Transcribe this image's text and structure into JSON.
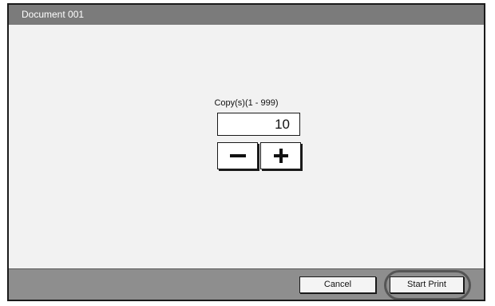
{
  "window": {
    "title": "Document 001"
  },
  "copies": {
    "label": "Copy(s)(1 - 999)",
    "value": "10"
  },
  "stepper": {
    "minus_icon": "minus-icon",
    "plus_icon": "plus-icon"
  },
  "actions": {
    "cancel_label": "Cancel",
    "start_print_label": "Start Print"
  },
  "colors": {
    "title_bar": "#7b7b7b",
    "content_bg": "#f2f2f2",
    "bottom_bar": "#8e8e8e",
    "highlight_ring": "#555555"
  }
}
